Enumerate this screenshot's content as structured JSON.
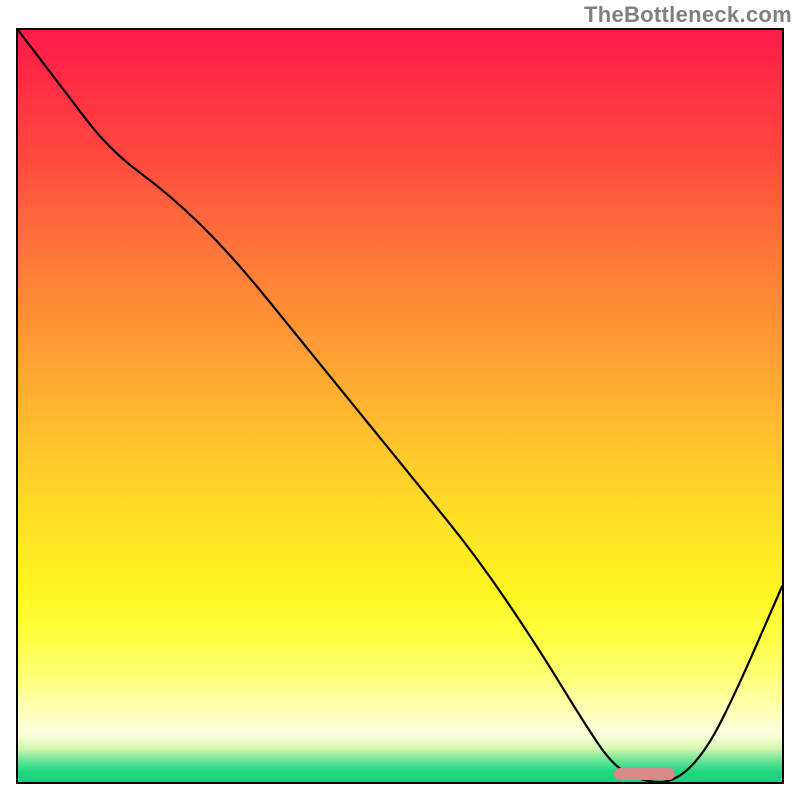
{
  "attribution": "TheBottleneck.com",
  "chart_data": {
    "type": "line",
    "title": "",
    "xlabel": "",
    "ylabel": "",
    "xlim": [
      0,
      100
    ],
    "ylim": [
      0,
      100
    ],
    "x": [
      0,
      6,
      12,
      20,
      28,
      36,
      44,
      52,
      60,
      68,
      74,
      78,
      82,
      86,
      90,
      94,
      100
    ],
    "values": [
      100,
      92,
      84,
      78,
      70,
      60,
      50,
      40,
      30,
      18,
      8,
      2,
      0,
      0,
      4,
      12,
      26
    ],
    "optimum_range": {
      "x_start": 78,
      "x_end": 86,
      "y": 0
    }
  },
  "colors": {
    "curve": "#000000",
    "marker": "#d88a88",
    "gradient_top": "#ff1a4a",
    "gradient_bottom": "#19d178"
  }
}
